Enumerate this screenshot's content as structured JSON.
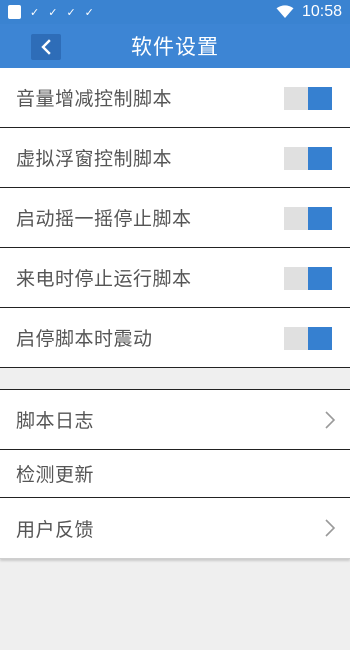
{
  "status_bar": {
    "time": "10:58",
    "notification_icons": [
      "app-icon",
      "check-icon",
      "check-icon",
      "check-icon",
      "check-icon"
    ],
    "tick_glyph": "✓"
  },
  "header": {
    "title": "软件设置",
    "back_icon": "chevron-left-icon"
  },
  "settings": [
    {
      "label": "音量增减控制脚本",
      "enabled": true
    },
    {
      "label": "虚拟浮窗控制脚本",
      "enabled": true
    },
    {
      "label": "启动摇一摇停止脚本",
      "enabled": true
    },
    {
      "label": "来电时停止运行脚本",
      "enabled": true
    },
    {
      "label": "启停脚本时震动",
      "enabled": true
    }
  ],
  "menu": [
    {
      "label": "脚本日志",
      "has_chevron": true
    },
    {
      "label": "检测更新",
      "has_chevron": false
    },
    {
      "label": "用户反馈",
      "has_chevron": true
    }
  ],
  "colors": {
    "accent": "#3d85d4",
    "toggle_on": "#3680d0",
    "toggle_track": "#e0e0e0",
    "background": "#efefef"
  }
}
